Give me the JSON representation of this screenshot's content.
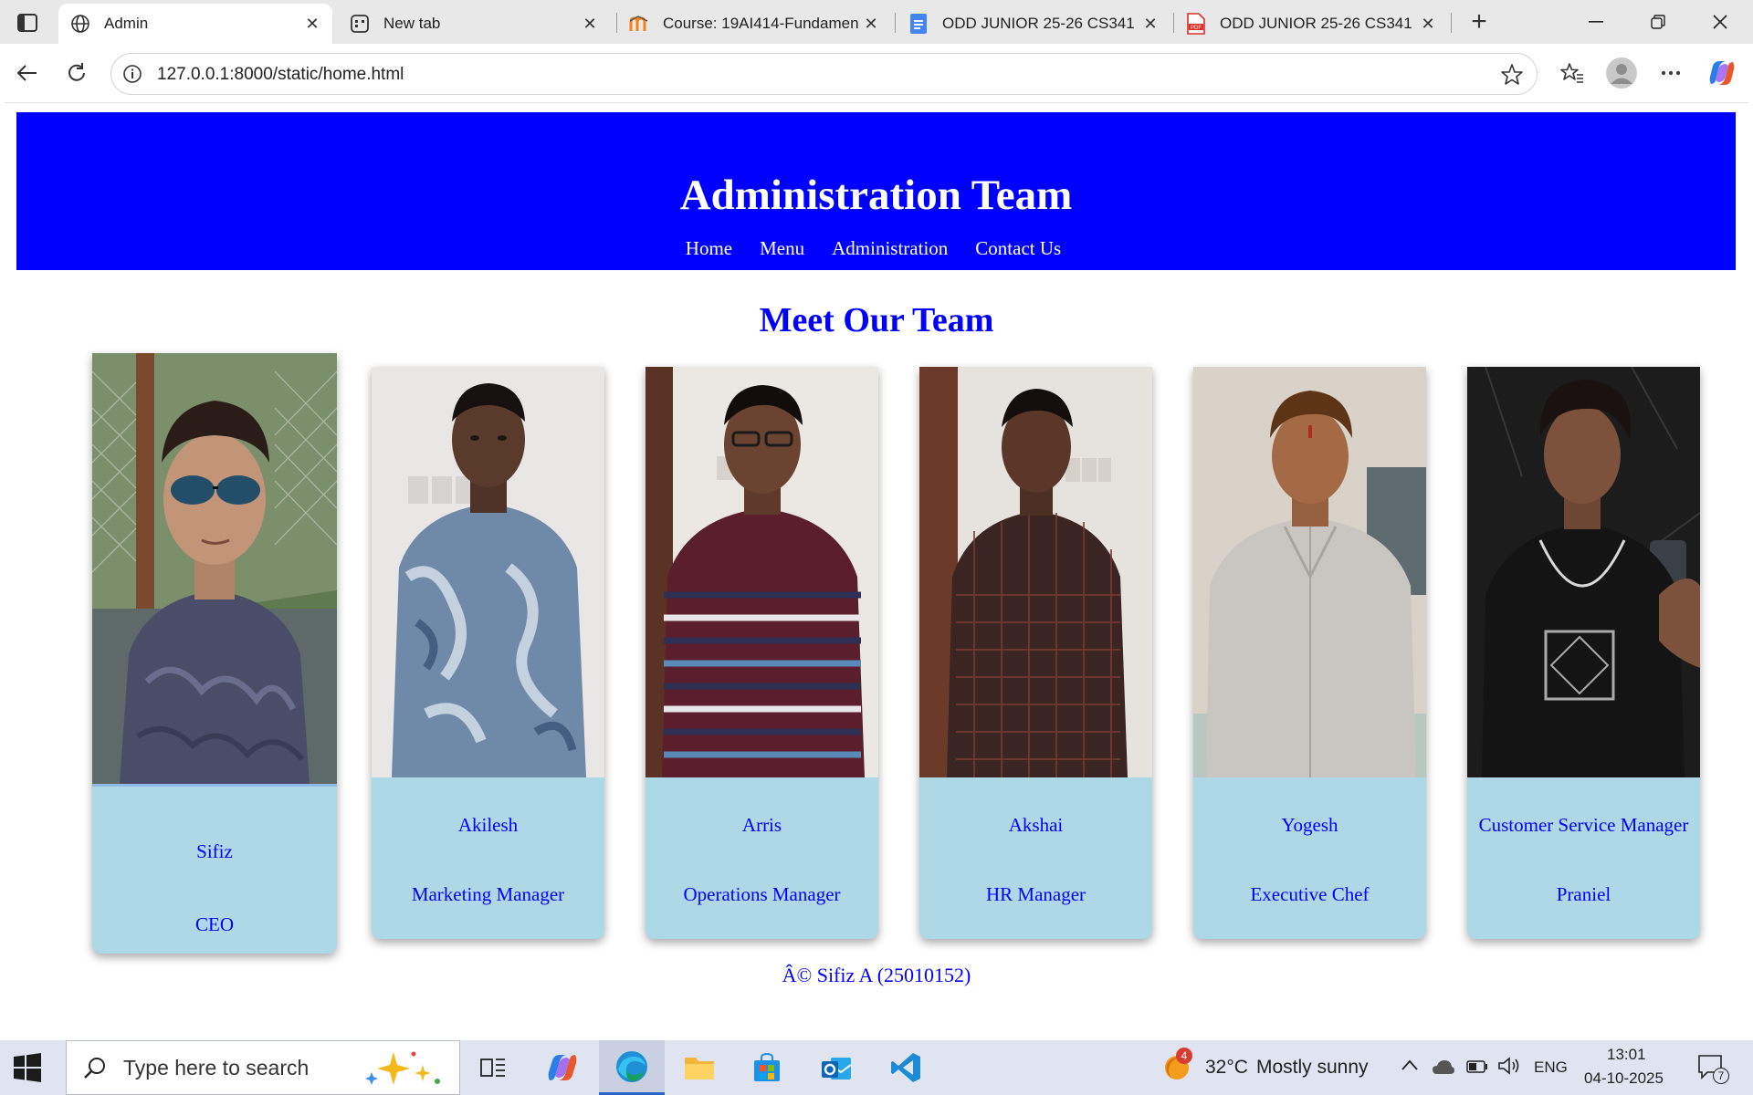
{
  "browser": {
    "tabs": [
      {
        "title": "Admin",
        "active": true,
        "icon": "globe-icon"
      },
      {
        "title": "New tab",
        "active": false,
        "icon": "newtab-icon"
      },
      {
        "title": "Course: 19AI414-Fundamen",
        "active": false,
        "icon": "moodle-icon"
      },
      {
        "title": "ODD JUNIOR 25-26 CS341",
        "active": false,
        "icon": "docs-icon"
      },
      {
        "title": "ODD JUNIOR 25-26 CS341",
        "active": false,
        "icon": "pdf-icon"
      }
    ],
    "url": "127.0.0.1:8000/static/home.html"
  },
  "page": {
    "header": {
      "title": "Administration Team",
      "nav": [
        "Home",
        "Menu",
        "Administration",
        "Contact Us"
      ],
      "background": "#0000ff"
    },
    "section_title": "Meet Our Team",
    "team": [
      {
        "name": "Sifiz",
        "role": "CEO"
      },
      {
        "name": "Akilesh",
        "role": "Marketing Manager"
      },
      {
        "name": "Arris",
        "role": "Operations Manager"
      },
      {
        "name": "Akshai",
        "role": "HR Manager"
      },
      {
        "name": "Yogesh",
        "role": "Executive Chef"
      },
      {
        "name": "Customer Service Manager",
        "role": "Praniel"
      }
    ],
    "footer": "Â© Sifiz A (25010152)",
    "card_background": "#add8e6"
  },
  "taskbar": {
    "search_placeholder": "Type here to search",
    "weather_temp": "32°C",
    "weather_text": "Mostly sunny",
    "weather_badge": "4",
    "language": "ENG",
    "time": "13:01",
    "date": "04-10-2025",
    "notification_count": "7"
  }
}
